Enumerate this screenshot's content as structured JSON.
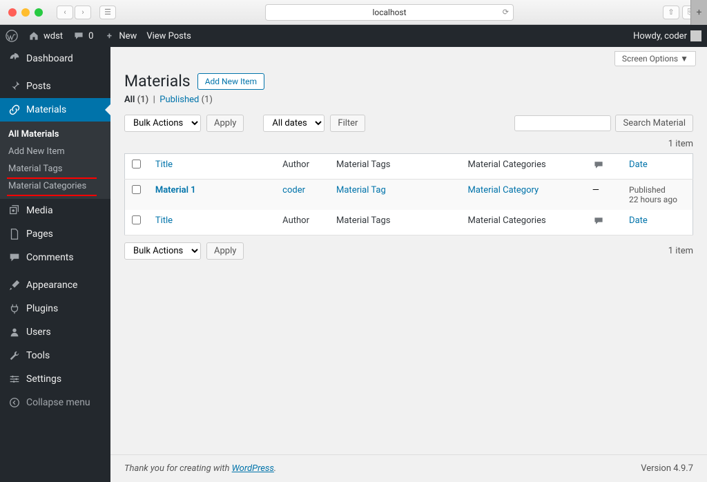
{
  "browser": {
    "url": "localhost"
  },
  "adminbar": {
    "site_name": "wdst",
    "comments_count": "0",
    "new_label": "New",
    "view_label": "View Posts",
    "howdy": "Howdy, coder"
  },
  "sidebar": {
    "dashboard": "Dashboard",
    "posts": "Posts",
    "materials": "Materials",
    "submenu": {
      "all": "All Materials",
      "add": "Add New Item",
      "tags": "Material Tags",
      "cats": "Material Categories"
    },
    "media": "Media",
    "pages": "Pages",
    "comments": "Comments",
    "appearance": "Appearance",
    "plugins": "Plugins",
    "users": "Users",
    "tools": "Tools",
    "settings": "Settings",
    "collapse": "Collapse menu"
  },
  "content": {
    "screen_options": "Screen Options",
    "heading": "Materials",
    "add_new": "Add New Item",
    "filter_all": "All",
    "filter_all_count": "(1)",
    "filter_published": "Published",
    "filter_published_count": "(1)",
    "bulk_actions": "Bulk Actions",
    "apply": "Apply",
    "all_dates": "All dates",
    "filter": "Filter",
    "search_placeholder": "",
    "search_button": "Search Material",
    "item_count": "1 item",
    "columns": {
      "title": "Title",
      "author": "Author",
      "tags": "Material Tags",
      "cats": "Material Categories",
      "date": "Date"
    },
    "rows": [
      {
        "title": "Material 1",
        "author": "coder",
        "tag": "Material Tag",
        "cat": "Material Category",
        "comments": "—",
        "date_status": "Published",
        "date_time": "22 hours ago"
      }
    ],
    "footer_text": "Thank you for creating with ",
    "footer_link": "WordPress",
    "footer_period": ".",
    "version": "Version 4.9.7"
  }
}
